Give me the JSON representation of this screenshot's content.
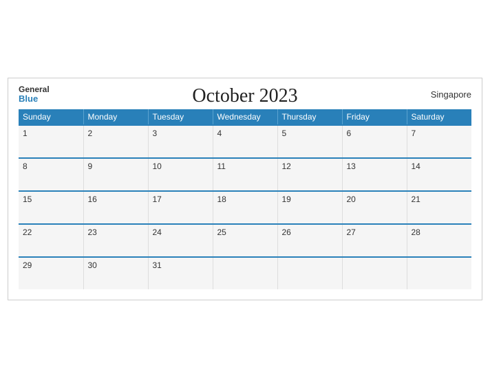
{
  "header": {
    "logo_general": "General",
    "logo_blue": "Blue",
    "title": "October 2023",
    "location": "Singapore"
  },
  "weekdays": [
    "Sunday",
    "Monday",
    "Tuesday",
    "Wednesday",
    "Thursday",
    "Friday",
    "Saturday"
  ],
  "weeks": [
    [
      {
        "day": "1",
        "empty": false
      },
      {
        "day": "2",
        "empty": false
      },
      {
        "day": "3",
        "empty": false
      },
      {
        "day": "4",
        "empty": false
      },
      {
        "day": "5",
        "empty": false
      },
      {
        "day": "6",
        "empty": false
      },
      {
        "day": "7",
        "empty": false
      }
    ],
    [
      {
        "day": "8",
        "empty": false
      },
      {
        "day": "9",
        "empty": false
      },
      {
        "day": "10",
        "empty": false
      },
      {
        "day": "11",
        "empty": false
      },
      {
        "day": "12",
        "empty": false
      },
      {
        "day": "13",
        "empty": false
      },
      {
        "day": "14",
        "empty": false
      }
    ],
    [
      {
        "day": "15",
        "empty": false
      },
      {
        "day": "16",
        "empty": false
      },
      {
        "day": "17",
        "empty": false
      },
      {
        "day": "18",
        "empty": false
      },
      {
        "day": "19",
        "empty": false
      },
      {
        "day": "20",
        "empty": false
      },
      {
        "day": "21",
        "empty": false
      }
    ],
    [
      {
        "day": "22",
        "empty": false
      },
      {
        "day": "23",
        "empty": false
      },
      {
        "day": "24",
        "empty": false
      },
      {
        "day": "25",
        "empty": false
      },
      {
        "day": "26",
        "empty": false
      },
      {
        "day": "27",
        "empty": false
      },
      {
        "day": "28",
        "empty": false
      }
    ],
    [
      {
        "day": "29",
        "empty": false
      },
      {
        "day": "30",
        "empty": false
      },
      {
        "day": "31",
        "empty": false
      },
      {
        "day": "",
        "empty": true
      },
      {
        "day": "",
        "empty": true
      },
      {
        "day": "",
        "empty": true
      },
      {
        "day": "",
        "empty": true
      }
    ]
  ]
}
